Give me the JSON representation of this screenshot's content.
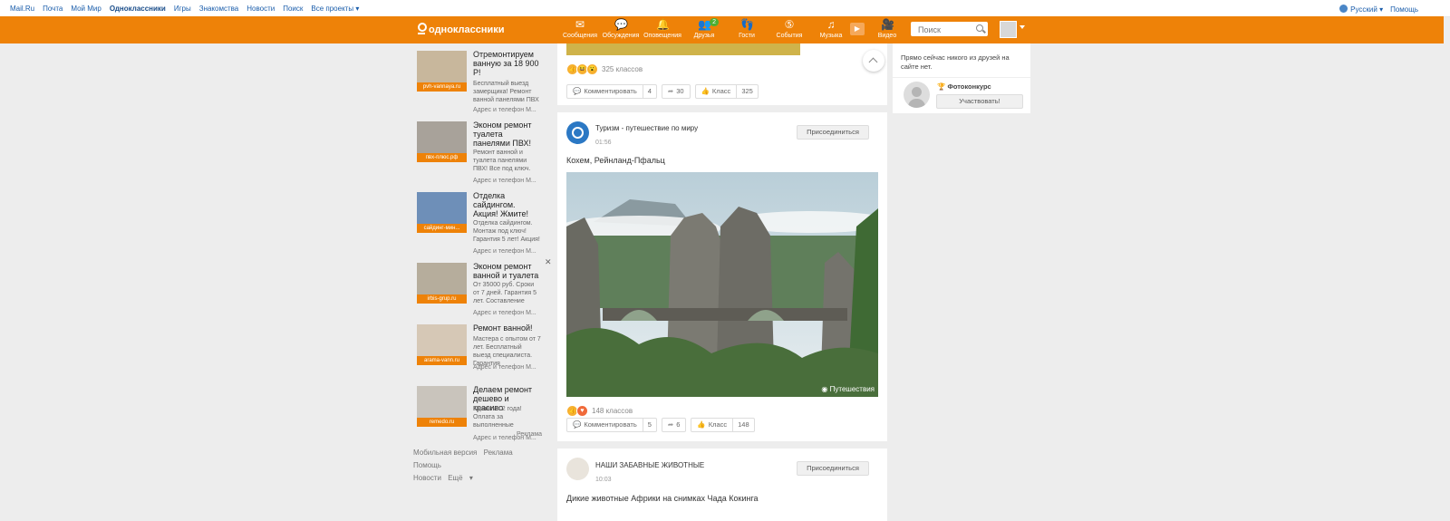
{
  "portal": {
    "links": [
      "Mail.Ru",
      "Почта",
      "Мой Мир",
      "Одноклассники",
      "Игры",
      "Знакомства",
      "Новости",
      "Поиск",
      "Все проекты"
    ],
    "language": "Русский",
    "help": "Помощь"
  },
  "header": {
    "logo": "одноклассники",
    "nav": [
      {
        "label": "Сообщения",
        "icon": "envelope-icon"
      },
      {
        "label": "Обсуждения",
        "icon": "chat-bubbles-icon"
      },
      {
        "label": "Оповещения",
        "icon": "bell-icon"
      },
      {
        "label": "Друзья",
        "icon": "friends-icon",
        "badge": "2"
      },
      {
        "label": "Гости",
        "icon": "footprints-icon"
      },
      {
        "label": "События",
        "icon": "events-icon"
      },
      {
        "label": "Музыка",
        "icon": "music-note-icon"
      },
      {
        "label": "Видео",
        "icon": "video-camera-icon"
      }
    ],
    "search_placeholder": "Поиск"
  },
  "ads": [
    {
      "domain": "pvh-vannaya.ru",
      "title": "Отремонтируем ванную за 18 900 Р!",
      "text": "Бесплатный выезд замерщика! Ремонт ванной панелями ПВХ",
      "footer": "Адрес и телефон   М..."
    },
    {
      "domain": "пвх-плюс.рф",
      "title": "Эконом ремонт туалета панелями ПВХ!",
      "text": "Ремонт ванной и туалета панелями ПВХ! Все под ключ.",
      "footer": "Адрес и телефон   М..."
    },
    {
      "domain": "сайдинг-мин...",
      "title": "Отделка сайдингом. Акция! Жмите!",
      "text": "Отделка сайдингом. Монтаж под ключ! Гарантия 5 лет! Акция!",
      "footer": "Адрес и телефон   М..."
    },
    {
      "domain": "irbis-grup.ru",
      "title": "Эконом ремонт ванной и туалета",
      "text": "От 35000 руб. Сроки от 7 дней. Гарантия 5 лет. Составление",
      "footer": "Адрес и телефон   М..."
    },
    {
      "domain": "arama-vann.ru",
      "title": "Ремонт ванной!",
      "text": "Мастера с опытом от 7 лет. Бесплатный выезд специалиста. Гарантия",
      "footer": "Адрес и телефон   М..."
    },
    {
      "domain": "remedo.ru",
      "title": "Делаем ремонт дешево и красиво",
      "text": "Гарантия 2 года! Оплата за выполненные",
      "footer": "Адрес и телефон   М..."
    }
  ],
  "ad_label": "Реклама",
  "footer_links": [
    "Мобильная версия",
    "Реклама",
    "Помощь",
    "Новости",
    "Ещё"
  ],
  "posts": [
    {
      "classes": "325 классов",
      "comment_label": "Комментировать",
      "comments": "4",
      "shares": "30",
      "like_label": "Класс",
      "likes": "325"
    },
    {
      "group": "Туризм - путешествие по миру",
      "time": "01:56",
      "join": "Присоединиться",
      "text": "Кохем, Рейнланд-Пфальц",
      "watermark": "Путешествия",
      "classes": "148 классов",
      "comment_label": "Комментировать",
      "comments": "5",
      "shares": "6",
      "like_label": "Класс",
      "likes": "148"
    },
    {
      "group": "НАШИ ЗАБАВНЫЕ ЖИВОТНЫЕ",
      "time": "10:03",
      "join": "Присоединиться",
      "text": "Дикие животные Африки на снимках Чада Кокинга"
    }
  ],
  "sidebar": {
    "friends_online": "Прямо сейчас никого из друзей на сайте нет.",
    "contest": "Фотоконкурс",
    "participate": "Участвовать!"
  },
  "colors": {
    "brand": "#ee8208",
    "badge": "#4eaf32"
  }
}
